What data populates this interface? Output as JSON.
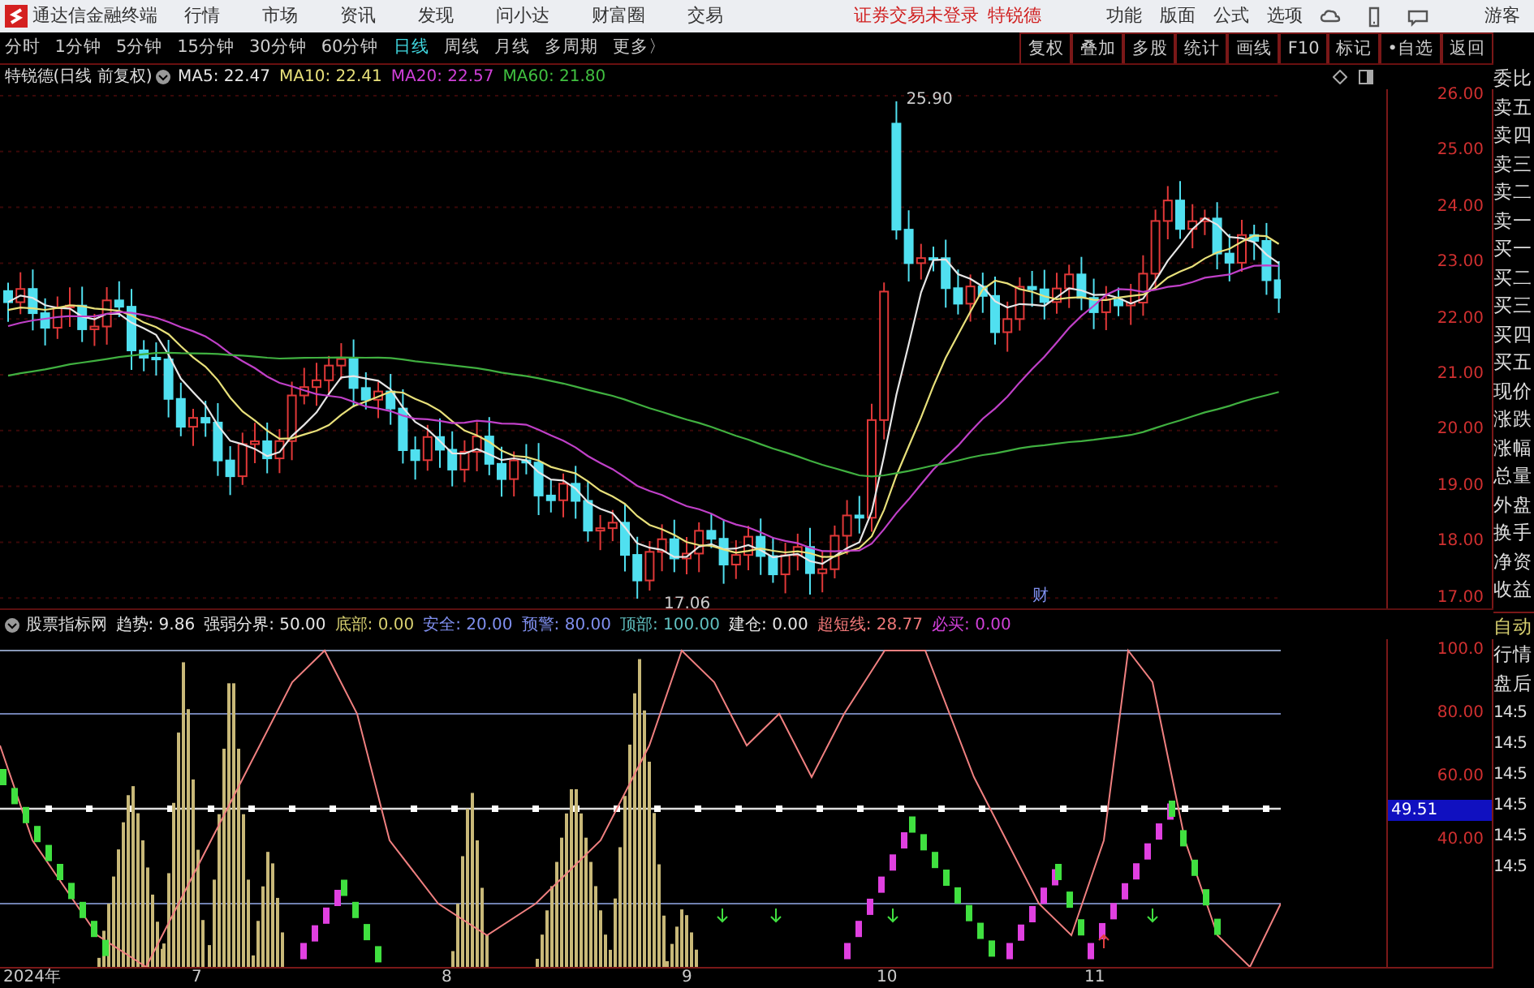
{
  "menu_bar": {
    "app_title": "通达信金融终端",
    "menus": [
      "行情",
      "市场",
      "资讯",
      "发现",
      "问小达",
      "财富圈",
      "交易"
    ],
    "login_status": "证券交易未登录",
    "stock_name": "特锐德",
    "tools": [
      "功能",
      "版面",
      "公式",
      "选项"
    ],
    "user": "游客"
  },
  "period_tabs": [
    {
      "label": "分时",
      "selected": false
    },
    {
      "label": "1分钟",
      "selected": false
    },
    {
      "label": "5分钟",
      "selected": false
    },
    {
      "label": "15分钟",
      "selected": false
    },
    {
      "label": "30分钟",
      "selected": false
    },
    {
      "label": "60分钟",
      "selected": false
    },
    {
      "label": "日线",
      "selected": true
    },
    {
      "label": "周线",
      "selected": false
    },
    {
      "label": "月线",
      "selected": false
    },
    {
      "label": "多周期",
      "selected": false
    },
    {
      "label": "更多〉",
      "selected": false
    }
  ],
  "toolbar_buttons": [
    "复权",
    "叠加",
    "多股",
    "统计",
    "画线",
    "F10",
    "标记",
    "•自选",
    "返回"
  ],
  "chart_header": {
    "title": "特锐德(日线 前复权)",
    "moving_averages": [
      {
        "label": "MA5:",
        "value": "22.47",
        "color": "#e6e6e6"
      },
      {
        "label": "MA10:",
        "value": "22.41",
        "color": "#e8e07a"
      },
      {
        "label": "MA20:",
        "value": "22.57",
        "color": "#d040d8"
      },
      {
        "label": "MA60:",
        "value": "21.80",
        "color": "#40c040"
      }
    ]
  },
  "price_axis": [
    "26.00",
    "25.00",
    "24.00",
    "23.00",
    "22.00",
    "21.00",
    "20.00",
    "19.00",
    "18.00",
    "17.00"
  ],
  "price_chart": {
    "high_label": "25.90",
    "low_label": "17.06",
    "event_marker": "财"
  },
  "indicator": {
    "name": "股票指标网",
    "params": [
      {
        "label": "趋势:",
        "value": "9.86",
        "color": "#e6e6e6"
      },
      {
        "label": "强弱分界:",
        "value": "50.00",
        "color": "#e6e6e6"
      },
      {
        "label": "底部:",
        "value": "0.00",
        "color": "#d8d070"
      },
      {
        "label": "安全:",
        "value": "20.00",
        "color": "#8090f0"
      },
      {
        "label": "预警:",
        "value": "80.00",
        "color": "#8090f0"
      },
      {
        "label": "顶部:",
        "value": "100.00",
        "color": "#60c0c0"
      },
      {
        "label": "建仓:",
        "value": "0.00",
        "color": "#e6e6e6"
      },
      {
        "label": "超短线:",
        "value": "28.77",
        "color": "#f07878"
      },
      {
        "label": "必买:",
        "value": "0.00",
        "color": "#d040d8"
      }
    ],
    "axis": [
      "100.0",
      "80.00",
      "60.00",
      "40.00"
    ],
    "current_value": "49.51"
  },
  "date_axis": [
    "2024年",
    "7",
    "8",
    "9",
    "10",
    "11"
  ],
  "quote_panel": {
    "labels": [
      "委比",
      "卖五",
      "卖四",
      "卖三",
      "卖二",
      "卖一",
      "买一",
      "买二",
      "买三",
      "买四",
      "买五",
      "现价",
      "涨跌",
      "涨幅",
      "总量",
      "外盘",
      "换手",
      "净资",
      "收益"
    ],
    "mode": "自动",
    "sections": [
      "行情",
      "盘后"
    ],
    "times": [
      "14:5",
      "14:5",
      "14:5",
      "14:5",
      "14:5",
      "14:5"
    ]
  }
}
